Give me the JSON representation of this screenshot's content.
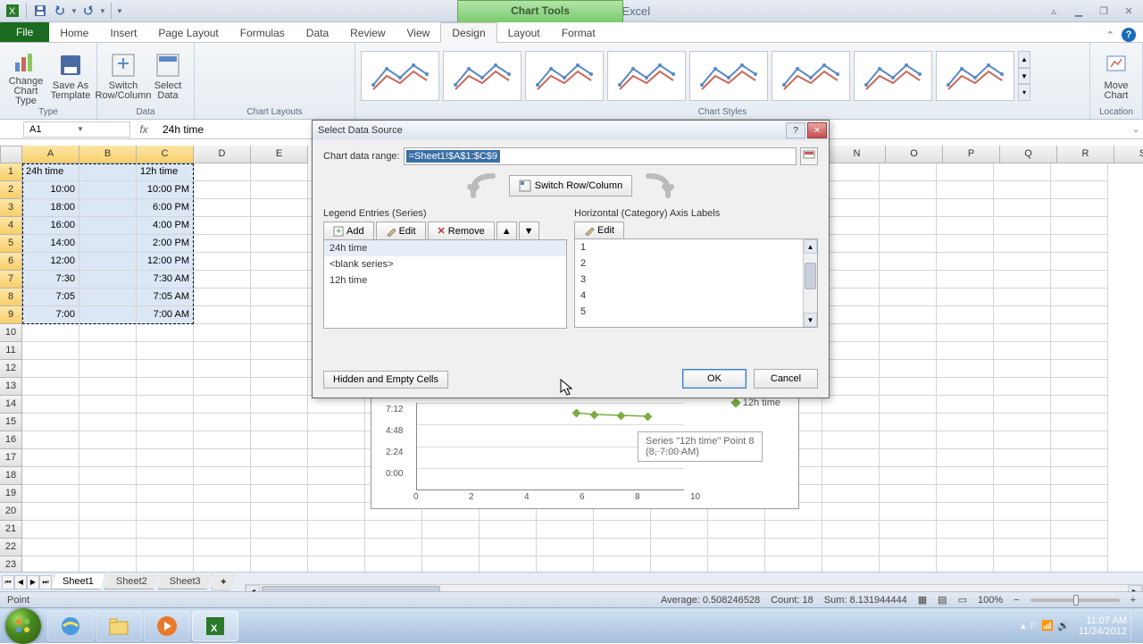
{
  "app_title": "Example - Microsoft Excel",
  "context_tab": "Chart Tools",
  "tabs": {
    "file": "File",
    "home": "Home",
    "insert": "Insert",
    "page_layout": "Page Layout",
    "formulas": "Formulas",
    "data": "Data",
    "review": "Review",
    "view": "View",
    "design": "Design",
    "layout": "Layout",
    "format": "Format"
  },
  "ribbon": {
    "type_group": "Type",
    "data_group": "Data",
    "layouts_group": "Chart Layouts",
    "styles_group": "Chart Styles",
    "location_group": "Location",
    "change_chart": "Change Chart Type",
    "save_template": "Save As Template",
    "switch_rc": "Switch Row/Column",
    "select_data": "Select Data",
    "move_chart": "Move Chart"
  },
  "name_box": "A1",
  "formula": "24h time",
  "columns": [
    "A",
    "B",
    "C",
    "D",
    "E",
    "",
    "",
    "",
    "",
    "",
    "",
    "",
    "",
    "N",
    "O",
    "P",
    "Q",
    "R",
    "S"
  ],
  "col_letters_right": [
    "N",
    "O",
    "P",
    "Q",
    "R",
    "S"
  ],
  "rows": 23,
  "selected_rows": 9,
  "table": {
    "header": [
      "24h time",
      "",
      "12h time"
    ],
    "rows": [
      [
        "10:00",
        "",
        "10:00 PM"
      ],
      [
        "18:00",
        "",
        "6:00 PM"
      ],
      [
        "16:00",
        "",
        "4:00 PM"
      ],
      [
        "14:00",
        "",
        "2:00 PM"
      ],
      [
        "12:00",
        "",
        "12:00 PM"
      ],
      [
        "7:30",
        "",
        "7:30 AM"
      ],
      [
        "7:05",
        "",
        "7:05 AM"
      ],
      [
        "7:00",
        "",
        "7:00 AM"
      ]
    ]
  },
  "dialog": {
    "title": "Select Data Source",
    "range_label": "Chart data range:",
    "range_value": "=Sheet1!$A$1:$C$9",
    "switch_btn": "Switch Row/Column",
    "legend_title": "Legend Entries (Series)",
    "axis_title": "Horizontal (Category) Axis Labels",
    "add": "Add",
    "edit": "Edit",
    "remove": "Remove",
    "series": [
      "24h time",
      "<blank series>",
      "12h time"
    ],
    "axis_labels": [
      "1",
      "2",
      "3",
      "4",
      "5"
    ],
    "hidden": "Hidden and Empty Cells",
    "ok": "OK",
    "cancel": "Cancel"
  },
  "chart": {
    "legend": "12h time",
    "y_ticks": [
      "7:12",
      "4:48",
      "2:24",
      "0:00"
    ],
    "x_ticks": [
      "0",
      "2",
      "4",
      "6",
      "8",
      "10"
    ],
    "tooltip_l1": "Series \"12h time\" Point 8",
    "tooltip_l2": "(8, 7:00 AM)"
  },
  "sheets": [
    "Sheet1",
    "Sheet2",
    "Sheet3"
  ],
  "status": {
    "mode": "Point",
    "avg": "Average: 0.508246528",
    "count": "Count: 18",
    "sum": "Sum: 8.131944444",
    "zoom": "100%"
  },
  "tray": {
    "time": "11:07 AM",
    "date": "11/24/2012"
  }
}
